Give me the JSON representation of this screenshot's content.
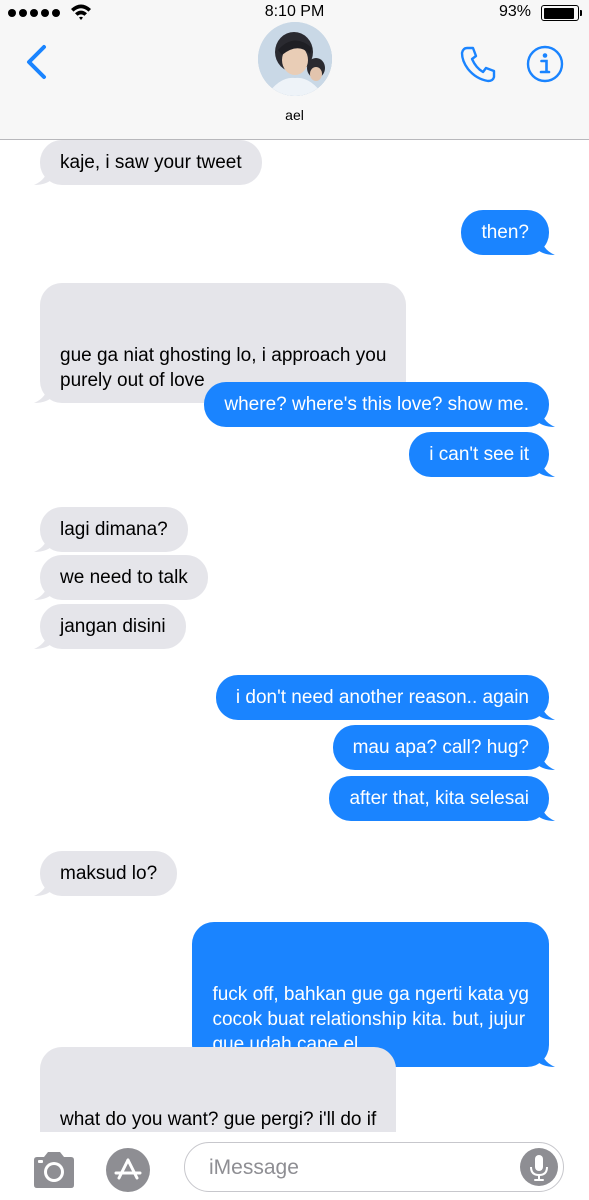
{
  "status_bar": {
    "time": "8:10 PM",
    "battery": "93%",
    "battery_level": 0.93
  },
  "header": {
    "contact_name": "ael",
    "back_icon": "chevron-left-icon",
    "call_icon": "phone-icon",
    "info_icon": "info-icon"
  },
  "messages": [
    {
      "from": "them",
      "text": "kaje, i saw your tweet"
    },
    {
      "from": "me",
      "text": "then?"
    },
    {
      "from": "them",
      "text": "gue ga niat ghosting lo, i approach you\npurely out of love"
    },
    {
      "from": "me",
      "text": "where? where's this love? show me."
    },
    {
      "from": "me",
      "text": "i can't see it"
    },
    {
      "from": "them",
      "text": "lagi dimana?"
    },
    {
      "from": "them",
      "text": "we need to talk"
    },
    {
      "from": "them",
      "text": "jangan disini"
    },
    {
      "from": "me",
      "text": "i don't need another reason.. again"
    },
    {
      "from": "me",
      "text": "mau apa? call? hug?"
    },
    {
      "from": "me",
      "text": "after that, kita selesai"
    },
    {
      "from": "them",
      "text": "maksud lo?"
    },
    {
      "from": "me",
      "text": "fuck off, bahkan gue ga ngerti kata yg\ncocok buat relationship kita. but, jujur\ngue udah cape el"
    },
    {
      "from": "them",
      "text": "what do you want? gue pergi? i'll do if\nthat's what you want"
    }
  ],
  "input_bar": {
    "placeholder": "iMessage",
    "camera_icon": "camera-icon",
    "apps_icon": "app-store-icon",
    "mic_icon": "microphone-icon"
  },
  "colors": {
    "accent": "#1a84ff",
    "incoming_bubble": "#e5e5ea",
    "outgoing_bubble": "#1a84ff",
    "icon_gray": "#8e8e93"
  }
}
